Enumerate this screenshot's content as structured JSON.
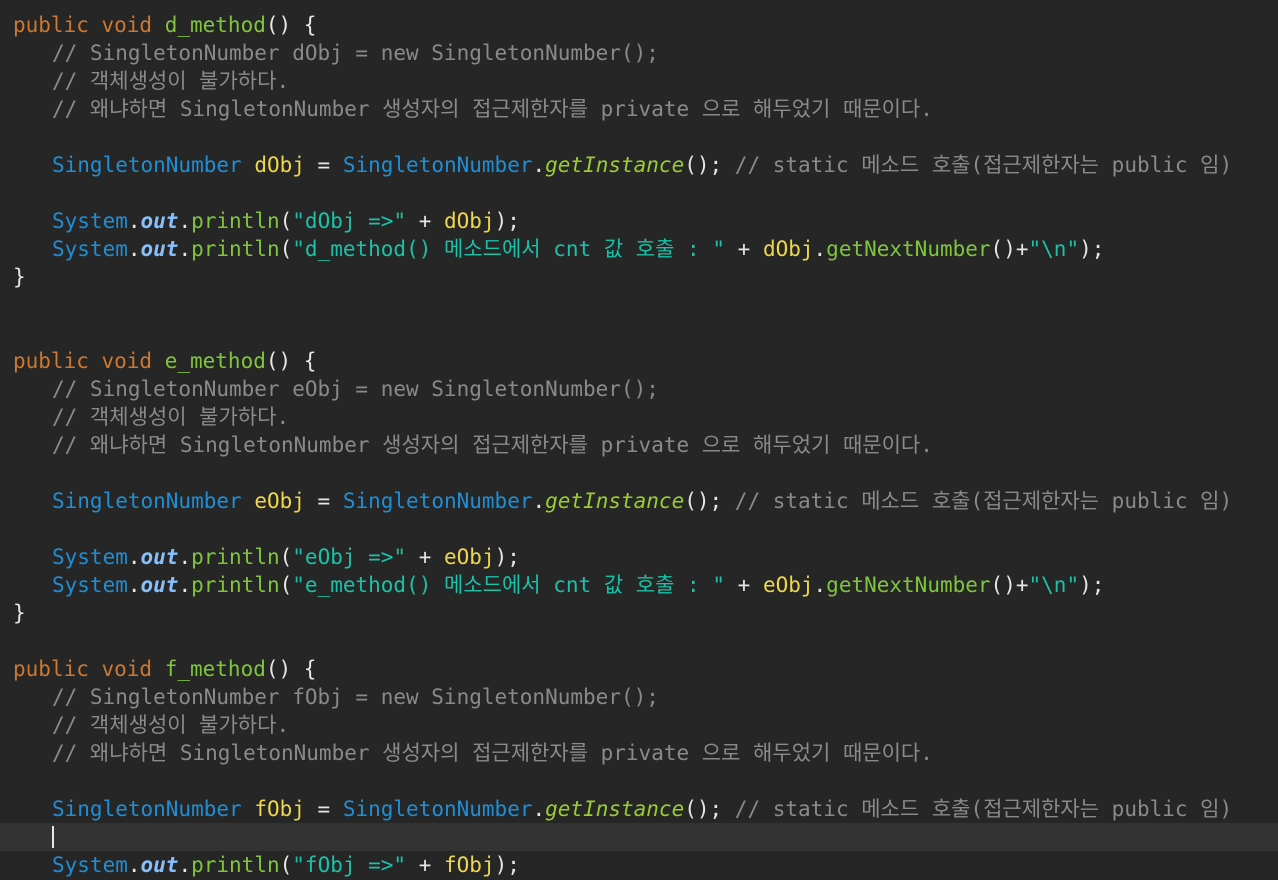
{
  "colors": {
    "background": "#262626",
    "current_line": "#333333",
    "keyword": "#cc7832",
    "method_name": "#7ec63b",
    "type": "#1e8fd6",
    "local_var": "#f0d64a",
    "static_call": "#9acd32",
    "field": "#87bffa",
    "string": "#19c2a8",
    "comment": "#8a8a8a",
    "plain": "#e6e6e6"
  },
  "lines": [
    {
      "indent": 0,
      "tokens": [
        [
          "kw",
          "public void "
        ],
        [
          "method",
          "d_method"
        ],
        [
          "plain",
          "() {"
        ]
      ]
    },
    {
      "indent": 1,
      "tokens": [
        [
          "comment",
          "// SingletonNumber dObj = new SingletonNumber();"
        ]
      ]
    },
    {
      "indent": 1,
      "tokens": [
        [
          "comment",
          "// 객체생성이 불가하다."
        ]
      ]
    },
    {
      "indent": 1,
      "tokens": [
        [
          "comment",
          "// 왜냐하면 SingletonNumber 생성자의 접근제한자를 private 으로 해두었기 때문이다."
        ]
      ]
    },
    {
      "indent": 0,
      "tokens": []
    },
    {
      "indent": 1,
      "tokens": [
        [
          "type",
          "SingletonNumber"
        ],
        [
          "plain",
          " "
        ],
        [
          "local",
          "dObj"
        ],
        [
          "plain",
          " = "
        ],
        [
          "type",
          "SingletonNumber"
        ],
        [
          "plain",
          "."
        ],
        [
          "static-call",
          "getInstance"
        ],
        [
          "plain",
          "(); "
        ],
        [
          "comment",
          "// static 메소드 호출(접근제한자는 public 임)"
        ]
      ]
    },
    {
      "indent": 0,
      "tokens": []
    },
    {
      "indent": 1,
      "tokens": [
        [
          "type",
          "System"
        ],
        [
          "plain",
          "."
        ],
        [
          "field",
          "out"
        ],
        [
          "plain",
          "."
        ],
        [
          "call",
          "println"
        ],
        [
          "plain",
          "("
        ],
        [
          "string",
          "\"dObj =>\""
        ],
        [
          "plain",
          " + "
        ],
        [
          "local",
          "dObj"
        ],
        [
          "plain",
          ");"
        ]
      ]
    },
    {
      "indent": 1,
      "tokens": [
        [
          "type",
          "System"
        ],
        [
          "plain",
          "."
        ],
        [
          "field",
          "out"
        ],
        [
          "plain",
          "."
        ],
        [
          "call",
          "println"
        ],
        [
          "plain",
          "("
        ],
        [
          "string",
          "\"d_method() 메소드에서 cnt 값 호출 : \""
        ],
        [
          "plain",
          " + "
        ],
        [
          "local",
          "dObj"
        ],
        [
          "plain",
          "."
        ],
        [
          "call",
          "getNextNumber"
        ],
        [
          "plain",
          "()+"
        ],
        [
          "string",
          "\""
        ],
        [
          "escape",
          "\\n"
        ],
        [
          "string",
          "\""
        ],
        [
          "plain",
          ");"
        ]
      ]
    },
    {
      "indent": 0,
      "tokens": [
        [
          "plain",
          "}"
        ]
      ]
    },
    {
      "indent": 0,
      "tokens": []
    },
    {
      "indent": 0,
      "tokens": []
    },
    {
      "indent": 0,
      "tokens": [
        [
          "kw",
          "public void "
        ],
        [
          "method",
          "e_method"
        ],
        [
          "plain",
          "() {"
        ]
      ]
    },
    {
      "indent": 1,
      "tokens": [
        [
          "comment",
          "// SingletonNumber eObj = new SingletonNumber();"
        ]
      ]
    },
    {
      "indent": 1,
      "tokens": [
        [
          "comment",
          "// 객체생성이 불가하다."
        ]
      ]
    },
    {
      "indent": 1,
      "tokens": [
        [
          "comment",
          "// 왜냐하면 SingletonNumber 생성자의 접근제한자를 private 으로 해두었기 때문이다."
        ]
      ]
    },
    {
      "indent": 0,
      "tokens": []
    },
    {
      "indent": 1,
      "tokens": [
        [
          "type",
          "SingletonNumber"
        ],
        [
          "plain",
          " "
        ],
        [
          "local",
          "eObj"
        ],
        [
          "plain",
          " = "
        ],
        [
          "type",
          "SingletonNumber"
        ],
        [
          "plain",
          "."
        ],
        [
          "static-call",
          "getInstance"
        ],
        [
          "plain",
          "(); "
        ],
        [
          "comment",
          "// static 메소드 호출(접근제한자는 public 임)"
        ]
      ]
    },
    {
      "indent": 0,
      "tokens": []
    },
    {
      "indent": 1,
      "tokens": [
        [
          "type",
          "System"
        ],
        [
          "plain",
          "."
        ],
        [
          "field",
          "out"
        ],
        [
          "plain",
          "."
        ],
        [
          "call",
          "println"
        ],
        [
          "plain",
          "("
        ],
        [
          "string",
          "\"eObj =>\""
        ],
        [
          "plain",
          " + "
        ],
        [
          "local",
          "eObj"
        ],
        [
          "plain",
          ");"
        ]
      ]
    },
    {
      "indent": 1,
      "tokens": [
        [
          "type",
          "System"
        ],
        [
          "plain",
          "."
        ],
        [
          "field",
          "out"
        ],
        [
          "plain",
          "."
        ],
        [
          "call",
          "println"
        ],
        [
          "plain",
          "("
        ],
        [
          "string",
          "\"e_method() 메소드에서 cnt 값 호출 : \""
        ],
        [
          "plain",
          " + "
        ],
        [
          "local",
          "eObj"
        ],
        [
          "plain",
          "."
        ],
        [
          "call",
          "getNextNumber"
        ],
        [
          "plain",
          "()+"
        ],
        [
          "string",
          "\""
        ],
        [
          "escape",
          "\\n"
        ],
        [
          "string",
          "\""
        ],
        [
          "plain",
          ");"
        ]
      ]
    },
    {
      "indent": 0,
      "tokens": [
        [
          "plain",
          "}"
        ]
      ]
    },
    {
      "indent": 0,
      "tokens": []
    },
    {
      "indent": 0,
      "tokens": [
        [
          "kw",
          "public void "
        ],
        [
          "method",
          "f_method"
        ],
        [
          "plain",
          "() {"
        ]
      ]
    },
    {
      "indent": 1,
      "tokens": [
        [
          "comment",
          "// SingletonNumber fObj = new SingletonNumber();"
        ]
      ]
    },
    {
      "indent": 1,
      "tokens": [
        [
          "comment",
          "// 객체생성이 불가하다."
        ]
      ]
    },
    {
      "indent": 1,
      "tokens": [
        [
          "comment",
          "// 왜냐하면 SingletonNumber 생성자의 접근제한자를 private 으로 해두었기 때문이다."
        ]
      ]
    },
    {
      "indent": 0,
      "tokens": []
    },
    {
      "indent": 1,
      "tokens": [
        [
          "type",
          "SingletonNumber"
        ],
        [
          "plain",
          " "
        ],
        [
          "local",
          "fObj"
        ],
        [
          "plain",
          " = "
        ],
        [
          "type",
          "SingletonNumber"
        ],
        [
          "plain",
          "."
        ],
        [
          "static-call",
          "getInstance"
        ],
        [
          "plain",
          "(); "
        ],
        [
          "comment",
          "// static 메소드 호출(접근제한자는 public 임)"
        ]
      ]
    },
    {
      "indent": 1,
      "tokens": [],
      "current": true,
      "cursor": true
    },
    {
      "indent": 1,
      "tokens": [
        [
          "type",
          "System"
        ],
        [
          "plain",
          "."
        ],
        [
          "field",
          "out"
        ],
        [
          "plain",
          "."
        ],
        [
          "call",
          "println"
        ],
        [
          "plain",
          "("
        ],
        [
          "string",
          "\"fObj =>\""
        ],
        [
          "plain",
          " + "
        ],
        [
          "local",
          "fObj"
        ],
        [
          "plain",
          ");"
        ]
      ]
    }
  ]
}
